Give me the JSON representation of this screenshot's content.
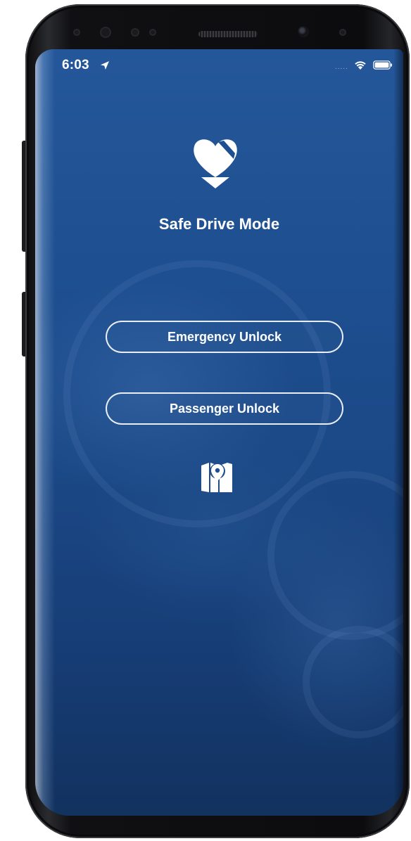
{
  "status_bar": {
    "time": "6:03",
    "signal_text": "....."
  },
  "app": {
    "title": "Safe Drive Mode",
    "logo_icon": "heart-shield-icon"
  },
  "actions": {
    "emergency_unlock": "Emergency Unlock",
    "passenger_unlock": "Passenger Unlock",
    "map_icon": "map-location-icon"
  },
  "colors": {
    "screen_top": "#24579a",
    "screen_bottom": "#12325f",
    "foreground": "#ffffff"
  }
}
